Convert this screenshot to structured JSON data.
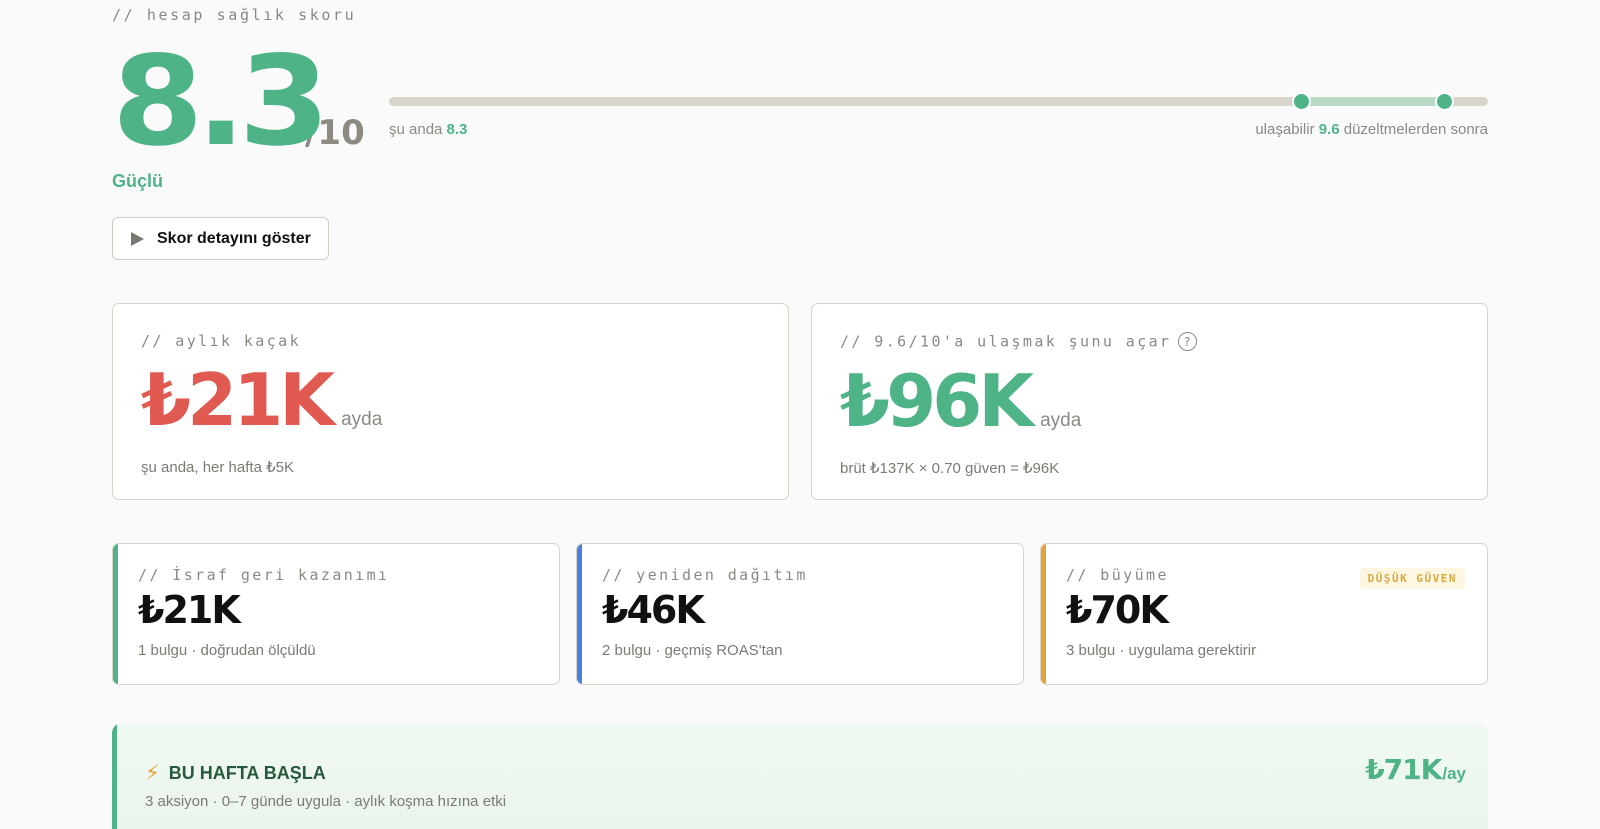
{
  "score": {
    "eyebrow": "// hesap sağlık skoru",
    "value": "8.3",
    "denominator": "/10",
    "label": "Güçlü",
    "current_value": 8.3,
    "potential_value": 9.6,
    "current_prefix": "şu anda ",
    "current_text": "8.3",
    "potential_prefix": "ulaşabilir ",
    "potential_text": "9.6",
    "potential_suffix": " düzeltmelerden sonra",
    "detail_button": "Skor detayını göster"
  },
  "leak": {
    "eyebrow": "// aylık kaçak",
    "value": "₺21K",
    "unit": "ayda",
    "note": "şu anda, her hafta ₺5K",
    "color": "#e05a52"
  },
  "unlock": {
    "eyebrow": "// 9.6/10'a ulaşmak şunu açar",
    "help": "?",
    "value": "₺96K",
    "unit": "ayda",
    "note": "brüt ₺137K × 0.70 güven = ₺96K",
    "color": "#4eb487"
  },
  "breakdown": [
    {
      "eyebrow": "// İsraf geri kazanımı",
      "value": "₺21K",
      "note": "1 bulgu · doğrudan ölçüldü",
      "color": "#4eb487",
      "badge": ""
    },
    {
      "eyebrow": "// yeniden dağıtım",
      "value": "₺46K",
      "note": "2 bulgu · geçmiş ROAS'tan",
      "color": "#4a7fe0",
      "badge": ""
    },
    {
      "eyebrow": "// büyüme",
      "value": "₺70K",
      "note": "3 bulgu · uygulama gerektirir",
      "color": "#e3a13a",
      "badge": "DÜŞÜK GÜVEN"
    }
  ],
  "week": {
    "icon": "lightning-icon",
    "title": "BU HAFTA BAŞLA",
    "subtitle": "3 aksiyon · 0–7 günde uygula · aylık koşma hızına etki",
    "value": "₺71K",
    "unit": "/ay"
  }
}
